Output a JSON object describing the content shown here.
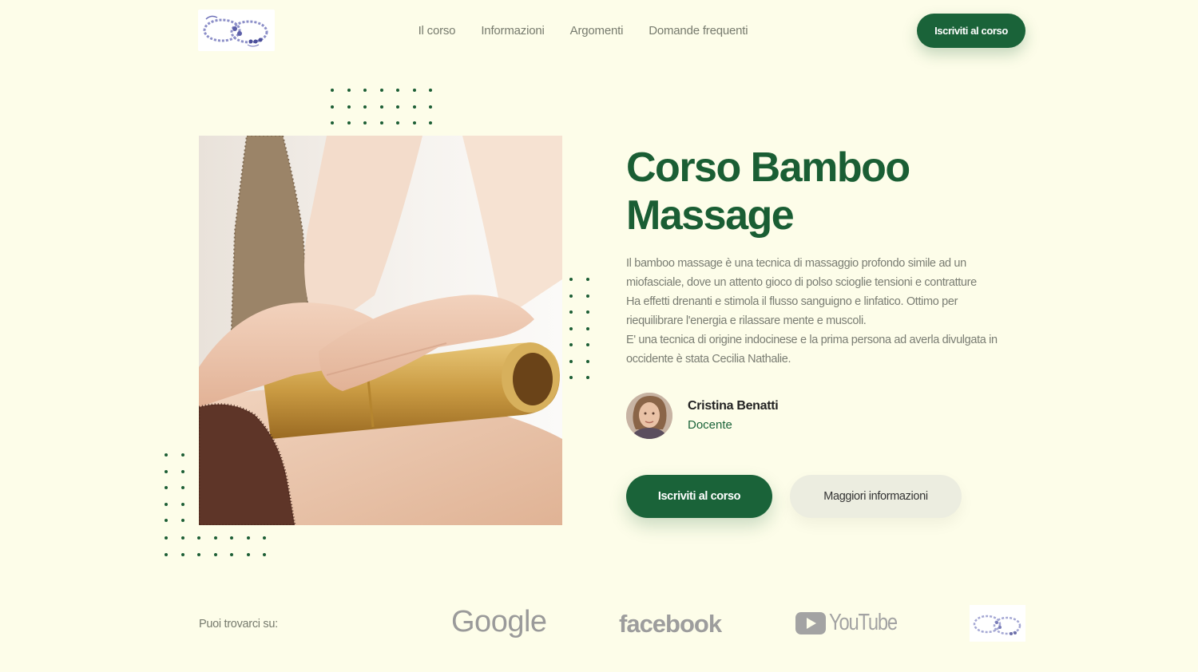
{
  "header": {
    "logo_icon": "libero-di-essere-logo",
    "nav": [
      {
        "label": "Il corso"
      },
      {
        "label": "Informazioni"
      },
      {
        "label": "Argomenti"
      },
      {
        "label": "Domande frequenti"
      }
    ],
    "cta_label": "Iscriviti al corso"
  },
  "hero": {
    "title": "Corso Bamboo Massage",
    "description": [
      "Il bamboo massage è una tecnica di massaggio profondo simile ad un miofasciale, dove un attento gioco di polso scioglie tensioni e contratture",
      "Ha effetti drenanti e stimola il flusso sanguigno e linfatico. Ottimo per riequilibrare l'energia e rilassare mente e muscoli.",
      "E' una tecnica di origine indocinese e la prima persona ad averla divulgata in occidente è stata Cecilia Nathalie."
    ],
    "teacher": {
      "name": "Cristina Benatti",
      "role": "Docente"
    },
    "primary_button": "Iscriviti al corso",
    "secondary_button": "Maggiori informazioni"
  },
  "footer": {
    "find_us_label": "Puoi trovarci su:",
    "brands": {
      "google": "Google",
      "facebook": "facebook",
      "youtube": "YouTube"
    }
  },
  "colors": {
    "background": "#fdfde9",
    "accent": "#1a6339",
    "title": "#1a5e34"
  }
}
